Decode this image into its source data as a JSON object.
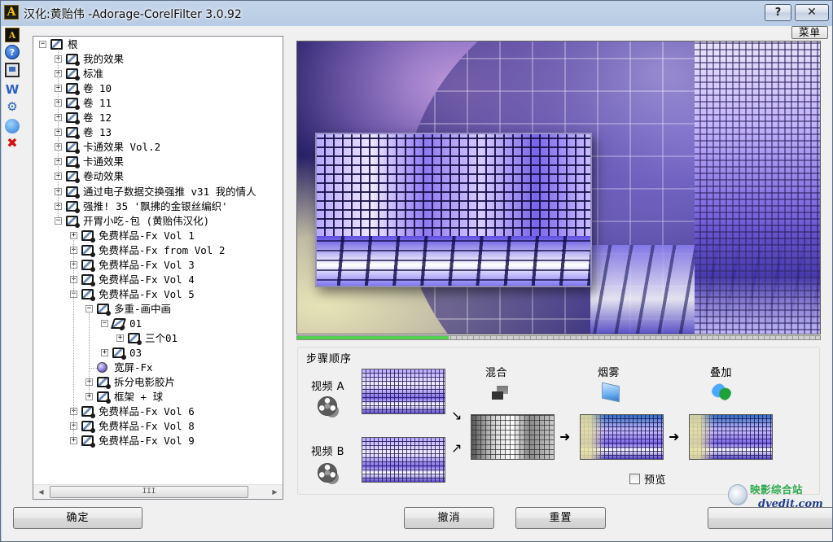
{
  "window": {
    "app_glyph": "A",
    "title": "汉化:黄贻伟 -Adorage-CorelFilter 3.0.92",
    "help_glyph": "?",
    "close_glyph": "✕"
  },
  "menu_button": "菜单",
  "side_toolbar": [
    {
      "name": "adorage-logo-icon",
      "glyph": "A"
    },
    {
      "name": "help-icon",
      "glyph": "?"
    },
    {
      "name": "preview-screen-icon",
      "glyph": ""
    },
    {
      "name": "w-icon",
      "glyph": "W"
    },
    {
      "name": "gear-icon",
      "glyph": "⚙"
    },
    {
      "name": "globe-icon",
      "glyph": ""
    },
    {
      "name": "delete-x-icon",
      "glyph": "✖"
    }
  ],
  "tree": {
    "items": [
      {
        "label": "根",
        "level": 0,
        "expander": "−",
        "icon": "folder"
      },
      {
        "label": "我的效果",
        "level": 1,
        "expander": "+",
        "icon": "folder"
      },
      {
        "label": "标准",
        "level": 1,
        "expander": "+",
        "icon": "folder"
      },
      {
        "label": "卷 10",
        "level": 1,
        "expander": "+",
        "icon": "folder"
      },
      {
        "label": "卷 11",
        "level": 1,
        "expander": "+",
        "icon": "folder"
      },
      {
        "label": "卷 12",
        "level": 1,
        "expander": "+",
        "icon": "folder"
      },
      {
        "label": "卷 13",
        "level": 1,
        "expander": "+",
        "icon": "folder"
      },
      {
        "label": "卡通效果 Vol.2",
        "level": 1,
        "expander": "+",
        "icon": "folder"
      },
      {
        "label": "卡通效果",
        "level": 1,
        "expander": "+",
        "icon": "folder"
      },
      {
        "label": "卷动效果",
        "level": 1,
        "expander": "+",
        "icon": "folder"
      },
      {
        "label": "通过电子数据交换强推 v31 我的情人",
        "level": 1,
        "expander": "+",
        "icon": "folder"
      },
      {
        "label": "强推! 35 '飘拂的金银丝编织'",
        "level": 1,
        "expander": "+",
        "icon": "folder"
      },
      {
        "label": "开胃小吃-包 (黄贻伟汉化)",
        "level": 1,
        "expander": "−",
        "icon": "folder"
      },
      {
        "label": "免费样品-Fx Vol 1",
        "level": 2,
        "expander": "+",
        "icon": "folder"
      },
      {
        "label": "免费样品-Fx from Vol 2",
        "level": 2,
        "expander": "+",
        "icon": "folder"
      },
      {
        "label": "免费样品-Fx Vol 3",
        "level": 2,
        "expander": "+",
        "icon": "folder"
      },
      {
        "label": "免费样品-Fx Vol 4",
        "level": 2,
        "expander": "+",
        "icon": "folder"
      },
      {
        "label": "免费样品-Fx Vol 5",
        "level": 2,
        "expander": "−",
        "icon": "folder"
      },
      {
        "label": "多重-画中画",
        "level": 3,
        "expander": "−",
        "icon": "folder"
      },
      {
        "label": "01",
        "level": 4,
        "expander": "−",
        "icon": "open-folder"
      },
      {
        "label": "三个01",
        "level": 5,
        "expander": "+",
        "icon": "folder"
      },
      {
        "label": "03",
        "level": 4,
        "expander": "+",
        "icon": "folder"
      },
      {
        "label": "宽屏-Fx",
        "level": 3,
        "expander": "",
        "icon": "sphere"
      },
      {
        "label": "拆分电影胶片",
        "level": 3,
        "expander": "+",
        "icon": "folder"
      },
      {
        "label": "框架 + 球",
        "level": 3,
        "expander": "+",
        "icon": "folder"
      },
      {
        "label": "免费样品-Fx Vol 6",
        "level": 2,
        "expander": "+",
        "icon": "folder"
      },
      {
        "label": "免费样品-Fx Vol 8",
        "level": 2,
        "expander": "+",
        "icon": "folder"
      },
      {
        "label": "免费样品-Fx Vol 9",
        "level": 2,
        "expander": "+",
        "icon": "folder"
      }
    ],
    "scroll_thumb_grip": "III",
    "scroll_left": "◀",
    "scroll_right": "▶"
  },
  "preview": {
    "progress_fraction": 0.29
  },
  "steps": {
    "title": "步骤顺序",
    "video_a": "视频 A",
    "video_b": "视频 B",
    "blend": "混合",
    "fog": "烟雾",
    "overlay": "叠加",
    "arrow_down_right": "↘",
    "arrow_up_right": "↗",
    "arrow_right": "➜",
    "preview_checkbox": "预览",
    "preview_checked": false
  },
  "buttons": {
    "ok": "确定",
    "undo": "撤消",
    "reset": "重置"
  },
  "watermark": {
    "text": "映影综合站",
    "url": "dvedit.com"
  }
}
